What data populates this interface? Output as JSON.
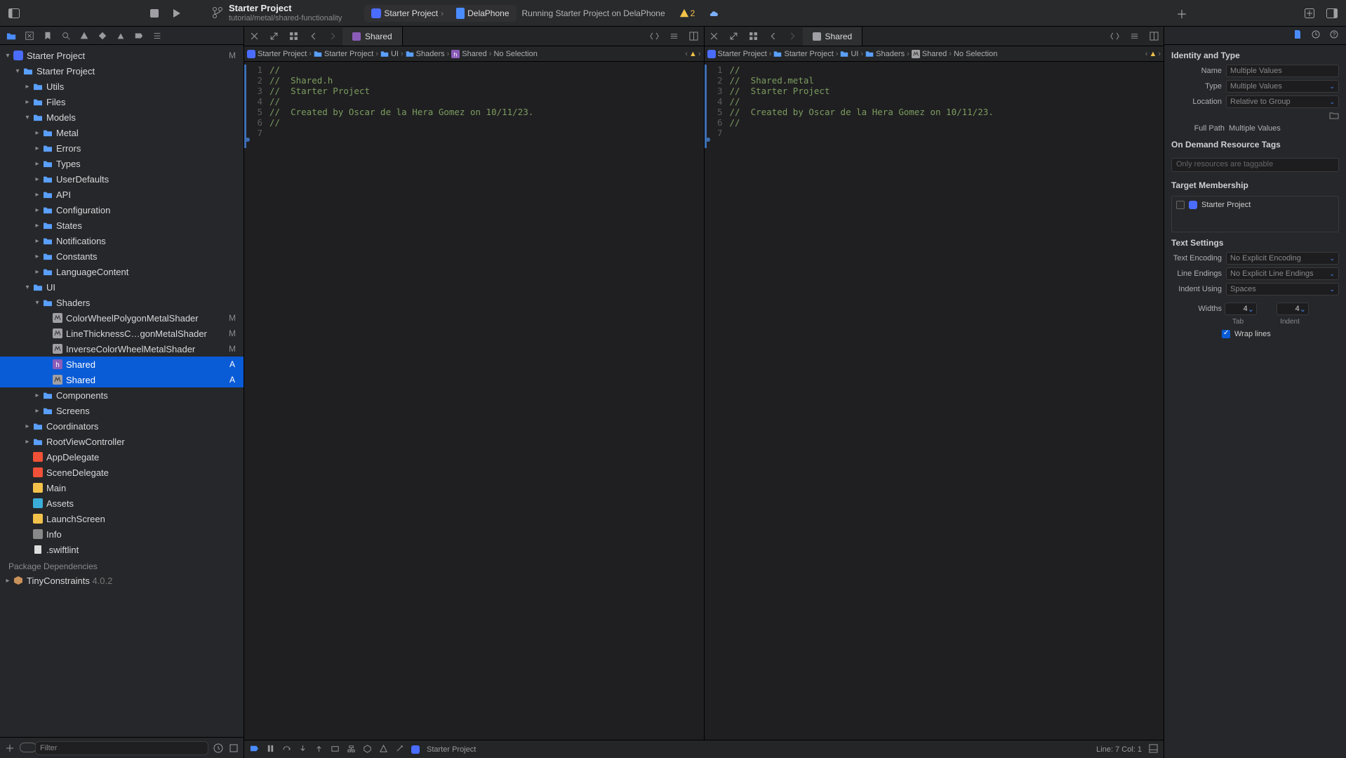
{
  "header": {
    "project_title": "Starter Project",
    "project_subtitle": "tutorial/metal/shared-functionality",
    "scheme": "Starter Project",
    "device": "DelaPhone",
    "activity": "Running Starter Project on DelaPhone",
    "warning_count": "2"
  },
  "navigator": {
    "root": "Starter Project",
    "root_status": "M",
    "project_group": "Starter Project",
    "groups": {
      "utils": "Utils",
      "files": "Files",
      "models": "Models",
      "metal": "Metal",
      "errors": "Errors",
      "types": "Types",
      "userdefaults": "UserDefaults",
      "api": "API",
      "configuration": "Configuration",
      "states": "States",
      "notifications": "Notifications",
      "constants": "Constants",
      "languagecontent": "LanguageContent",
      "ui": "UI",
      "shaders": "Shaders",
      "components": "Components",
      "screens": "Screens",
      "coordinators": "Coordinators",
      "rootvc": "RootViewController"
    },
    "shader_files": [
      {
        "name": "ColorWheelPolygonMetalShader",
        "status": "M"
      },
      {
        "name": "LineThicknessC…gonMetalShader",
        "status": "M"
      },
      {
        "name": "InverseColorWheelMetalShader",
        "status": "M"
      },
      {
        "name": "Shared",
        "status": "A",
        "kind": "h"
      },
      {
        "name": "Shared",
        "status": "A",
        "kind": "metal"
      }
    ],
    "files": {
      "appdelegate": "AppDelegate",
      "scenedelegate": "SceneDelegate",
      "main": "Main",
      "assets": "Assets",
      "launchscreen": "LaunchScreen",
      "info": "Info",
      "swiftlint": ".swiftlint"
    },
    "package_dependencies_label": "Package Dependencies",
    "package_name": "TinyConstraints",
    "package_version": "4.0.2",
    "filter_placeholder": "Filter"
  },
  "editor": {
    "left": {
      "tab_label": "Shared",
      "crumbs": [
        "Starter Project",
        "Starter Project",
        "UI",
        "Shaders",
        "Shared",
        "No Selection"
      ],
      "lines": [
        "//",
        "//  Shared.h",
        "//  Starter Project",
        "//",
        "//  Created by Oscar de la Hera Gomez on 10/11/23.",
        "//",
        ""
      ]
    },
    "right": {
      "tab_label": "Shared",
      "crumbs": [
        "Starter Project",
        "Starter Project",
        "UI",
        "Shaders",
        "Shared",
        "No Selection"
      ],
      "lines": [
        "//",
        "//  Shared.metal",
        "//  Starter Project",
        "//",
        "//  Created by Oscar de la Hera Gomez on 10/11/23.",
        "//",
        ""
      ]
    }
  },
  "debug": {
    "target": "Starter Project",
    "cursor": "Line: 7   Col: 1"
  },
  "inspector": {
    "identity_title": "Identity and Type",
    "name_label": "Name",
    "name_value": "Multiple Values",
    "type_label": "Type",
    "type_value": "Multiple Values",
    "location_label": "Location",
    "location_value": "Relative to Group",
    "fullpath_label": "Full Path",
    "fullpath_value": "Multiple Values",
    "odr_title": "On Demand Resource Tags",
    "odr_placeholder": "Only resources are taggable",
    "target_title": "Target Membership",
    "target_name": "Starter Project",
    "text_title": "Text Settings",
    "encoding_label": "Text Encoding",
    "encoding_value": "No Explicit Encoding",
    "endings_label": "Line Endings",
    "endings_value": "No Explicit Line Endings",
    "indent_label": "Indent Using",
    "indent_value": "Spaces",
    "widths_label": "Widths",
    "tab_width": "4",
    "indent_width": "4",
    "tab_sublabel": "Tab",
    "indent_sublabel": "Indent",
    "wrap_label": "Wrap lines"
  }
}
